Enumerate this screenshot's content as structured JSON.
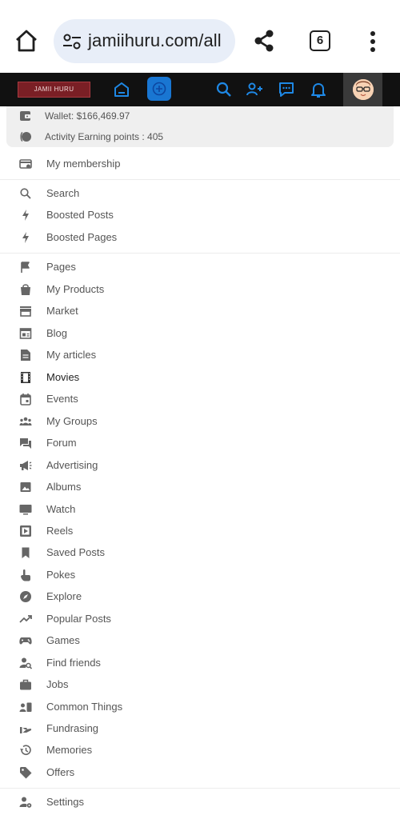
{
  "browser": {
    "url": "jamiihuru.com/all",
    "tab_count": "6"
  },
  "header": {
    "logo_text": "JAMII HURU",
    "accent": "#1976d2"
  },
  "wallet": {
    "balance": "Wallet: $166,469.97",
    "points": "Activity Earning points : 405"
  },
  "menu": {
    "membership": "My membership",
    "search": "Search",
    "boosted_posts": "Boosted Posts",
    "boosted_pages": "Boosted Pages",
    "pages": "Pages",
    "my_products": "My Products",
    "market": "Market",
    "blog": "Blog",
    "my_articles": "My articles",
    "movies": "Movies",
    "events": "Events",
    "my_groups": "My Groups",
    "forum": "Forum",
    "advertising": "Advertising",
    "albums": "Albums",
    "watch": "Watch",
    "reels": "Reels",
    "saved_posts": "Saved Posts",
    "pokes": "Pokes",
    "explore": "Explore",
    "popular_posts": "Popular Posts",
    "games": "Games",
    "find_friends": "Find friends",
    "jobs": "Jobs",
    "common_things": "Common Things",
    "fundrasing": "Fundrasing",
    "memories": "Memories",
    "offers": "Offers",
    "settings": "Settings"
  }
}
